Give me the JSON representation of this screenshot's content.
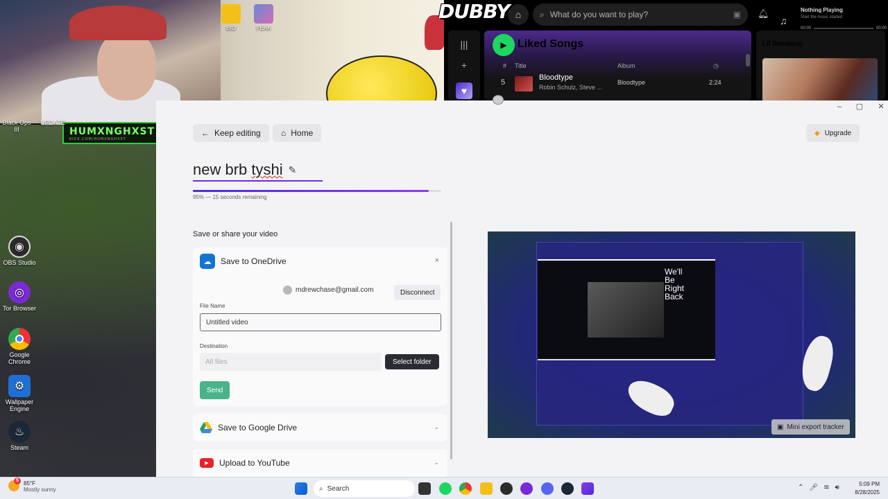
{
  "desktop": {
    "overlay_logo": "HUMXNGHXST",
    "overlay_logo_sub": "KICK.COM/HUMXNGHXST",
    "top_icons": [
      {
        "label": "BIO"
      },
      {
        "label": "PEAK"
      }
    ],
    "icons": [
      {
        "label": "Black Ops III"
      },
      {
        "label": "UPDATE"
      },
      {
        "label": "OBS Studio"
      },
      {
        "label": "Tor Browser"
      },
      {
        "label": "Google Chrome"
      },
      {
        "label": "Wallpaper Engine"
      },
      {
        "label": "Steam"
      }
    ]
  },
  "spotify": {
    "logo": "DUBBY",
    "search_placeholder": "What do you want to play?",
    "now_playing": "Nothing Playing",
    "now_playing_sub": "Start the music started",
    "time_start": "00:00",
    "time_end": "00:00",
    "playlist_title": "Liked Songs",
    "columns": {
      "num": "#",
      "title": "Title",
      "album": "Album"
    },
    "track": {
      "num": "5",
      "title": "Bloodtype",
      "artist": "Robin Schulz, Steve ...",
      "album": "Bloodtype",
      "duration": "2:24"
    },
    "side_artist": "Lil Boodang"
  },
  "editor": {
    "keep_editing": "Keep editing",
    "home": "Home",
    "upgrade": "Upgrade",
    "project_title_a": "new brb ",
    "project_title_b": "tyshi",
    "progress_percent": 95,
    "progress_text": "95% — 15 seconds remaining",
    "save_heading": "Save or share your video",
    "onedrive": {
      "title": "Save to OneDrive",
      "close": "×",
      "account": "mdrewchase@gmail.com",
      "disconnect": "Disconnect",
      "file_name_label": "File Name",
      "file_name_value": "Untitled video",
      "destination_label": "Destination",
      "destination_placeholder": "All files",
      "select_folder": "Select folder",
      "send": "Send"
    },
    "google_drive": {
      "title": "Save to Google Drive"
    },
    "youtube": {
      "title": "Upload to YouTube"
    },
    "preview_text": "We'll\nBe\nRight\nBack",
    "mini_export": "Mini export tracker"
  },
  "taskbar": {
    "weather_temp": "85°F",
    "weather_desc": "Mostly sunny",
    "weather_badge": "5",
    "search": "Search",
    "time": "5:09 PM",
    "date": "8/28/2025"
  }
}
